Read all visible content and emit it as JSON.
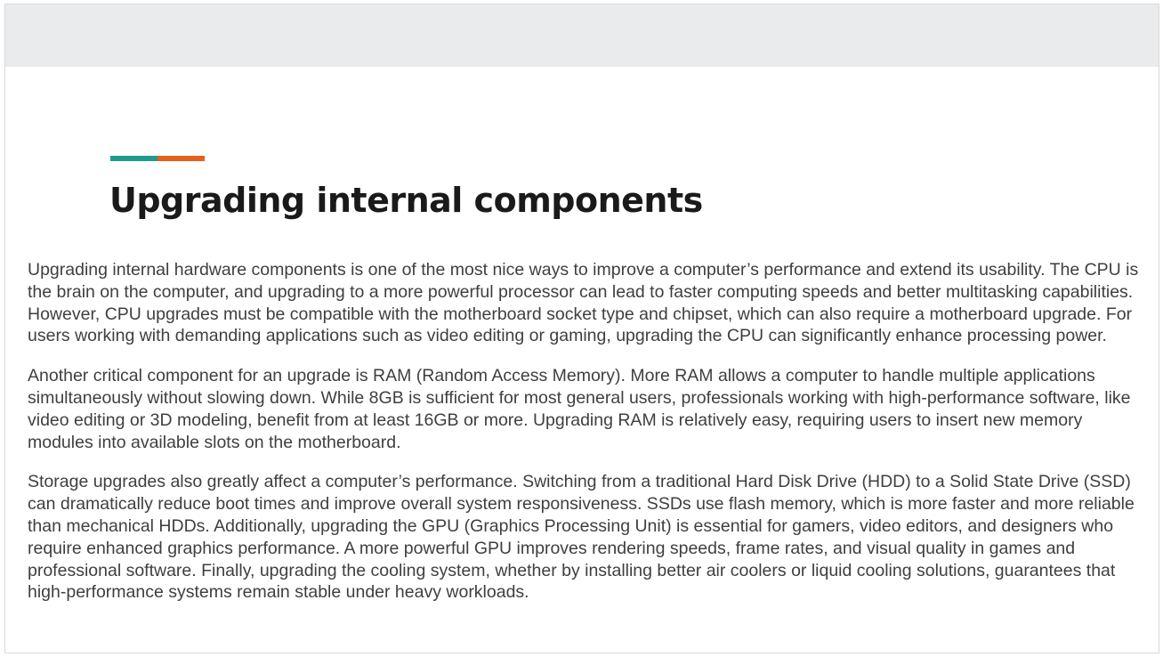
{
  "colors": {
    "accent_teal": "#1f9a8e",
    "accent_orange": "#e2621b",
    "top_band": "#e9ebec"
  },
  "slide": {
    "title": "Upgrading internal components",
    "paragraphs": [
      "Upgrading internal hardware components is one of the most nice ways to improve a computer’s performance and extend its usability. The CPU is the brain on the computer, and upgrading to a more powerful processor can lead to faster computing speeds and better multitasking capabilities. However, CPU upgrades must be compatible with the motherboard socket type and chipset, which can also require a motherboard upgrade. For users working with demanding applications such as video editing or gaming, upgrading the CPU can significantly enhance processing power.",
      "Another critical component for an upgrade is RAM (Random Access Memory). More RAM allows a computer to handle multiple applications simultaneously without slowing down. While 8GB is sufficient for most general users, professionals working with high-performance software, like video editing or 3D modeling, benefit from at least 16GB or more. Upgrading RAM is relatively easy, requiring users to insert new memory modules into available slots on the motherboard.",
      "Storage upgrades also greatly affect a computer’s performance. Switching from a traditional Hard Disk Drive (HDD) to a Solid State Drive (SSD) can dramatically reduce boot times and improve overall system responsiveness. SSDs use flash memory, which is more faster and more reliable than mechanical HDDs. Additionally, upgrading the GPU (Graphics Processing Unit) is essential for gamers, video editors, and designers who require enhanced graphics performance. A more powerful GPU improves rendering speeds, frame rates, and visual quality in games and professional software. Finally, upgrading the cooling system, whether by installing better air coolers or liquid cooling solutions, guarantees that high-performance systems remain stable under heavy workloads."
    ]
  }
}
